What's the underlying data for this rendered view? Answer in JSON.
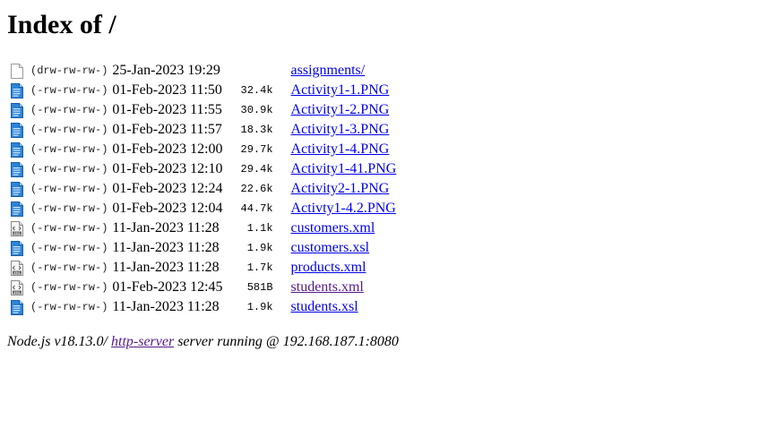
{
  "page": {
    "title": "Index of /",
    "footer": {
      "prefix": "Node.js v18.13.0/ ",
      "link_text": "http-server",
      "suffix": " server running @ 192.168.187.1:8080"
    }
  },
  "entries": [
    {
      "icon": "blank-file-icon",
      "perms": "(drw-rw-rw-)",
      "date": "25-Jan-2023 19:29",
      "size": "",
      "name": "assignments/",
      "visited": false
    },
    {
      "icon": "image-file-icon",
      "perms": "(-rw-rw-rw-)",
      "date": "01-Feb-2023 11:50",
      "size": "32.4k",
      "name": "Activity1-1.PNG",
      "visited": false
    },
    {
      "icon": "image-file-icon",
      "perms": "(-rw-rw-rw-)",
      "date": "01-Feb-2023 11:55",
      "size": "30.9k",
      "name": "Activity1-2.PNG",
      "visited": false
    },
    {
      "icon": "image-file-icon",
      "perms": "(-rw-rw-rw-)",
      "date": "01-Feb-2023 11:57",
      "size": "18.3k",
      "name": "Activity1-3.PNG",
      "visited": false
    },
    {
      "icon": "image-file-icon",
      "perms": "(-rw-rw-rw-)",
      "date": "01-Feb-2023 12:00",
      "size": "29.7k",
      "name": "Activity1-4.PNG",
      "visited": false
    },
    {
      "icon": "image-file-icon",
      "perms": "(-rw-rw-rw-)",
      "date": "01-Feb-2023 12:10",
      "size": "29.4k",
      "name": "Activity1-41.PNG",
      "visited": false
    },
    {
      "icon": "image-file-icon",
      "perms": "(-rw-rw-rw-)",
      "date": "01-Feb-2023 12:24",
      "size": "22.6k",
      "name": "Activity2-1.PNG",
      "visited": false
    },
    {
      "icon": "image-file-icon",
      "perms": "(-rw-rw-rw-)",
      "date": "01-Feb-2023 12:04",
      "size": "44.7k",
      "name": "Activty1-4.2.PNG",
      "visited": false
    },
    {
      "icon": "xml-file-icon",
      "perms": "(-rw-rw-rw-)",
      "date": "11-Jan-2023 11:28",
      "size": "1.1k",
      "name": "customers.xml",
      "visited": false
    },
    {
      "icon": "image-file-icon",
      "perms": "(-rw-rw-rw-)",
      "date": "11-Jan-2023 11:28",
      "size": "1.9k",
      "name": "customers.xsl",
      "visited": false
    },
    {
      "icon": "xml-file-icon",
      "perms": "(-rw-rw-rw-)",
      "date": "11-Jan-2023 11:28",
      "size": "1.7k",
      "name": "products.xml",
      "visited": false
    },
    {
      "icon": "xml-file-icon",
      "perms": "(-rw-rw-rw-)",
      "date": "01-Feb-2023 12:45",
      "size": "581B",
      "name": "students.xml",
      "visited": true
    },
    {
      "icon": "image-file-icon",
      "perms": "(-rw-rw-rw-)",
      "date": "11-Jan-2023 11:28",
      "size": "1.9k",
      "name": "students.xsl",
      "visited": false
    }
  ]
}
